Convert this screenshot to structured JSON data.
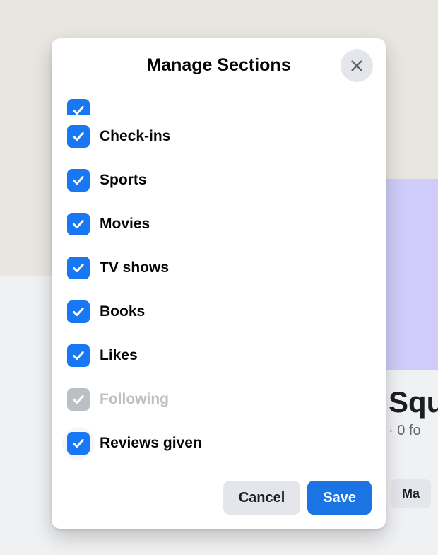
{
  "dialog": {
    "title": "Manage Sections",
    "close_label": "Close"
  },
  "sections": [
    {
      "label": "",
      "checked": true,
      "disabled": false,
      "partial": true
    },
    {
      "label": "Check-ins",
      "checked": true,
      "disabled": false
    },
    {
      "label": "Sports",
      "checked": true,
      "disabled": false
    },
    {
      "label": "Movies",
      "checked": true,
      "disabled": false
    },
    {
      "label": "TV shows",
      "checked": true,
      "disabled": false
    },
    {
      "label": "Books",
      "checked": true,
      "disabled": false
    },
    {
      "label": "Likes",
      "checked": true,
      "disabled": false
    },
    {
      "label": "Following",
      "checked": true,
      "disabled": true
    },
    {
      "label": "Reviews given",
      "checked": true,
      "disabled": false,
      "focus": true
    }
  ],
  "buttons": {
    "cancel": "Cancel",
    "save": "Save"
  },
  "background": {
    "title_fragment": "Squ",
    "subtitle_fragment": "· 0 fo",
    "button_fragment": "Ma"
  }
}
